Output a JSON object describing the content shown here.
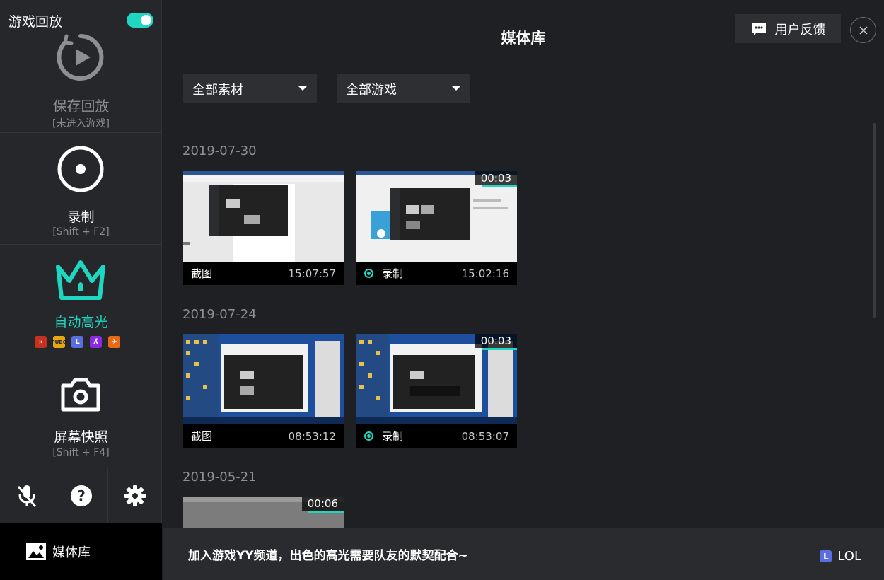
{
  "sidebar": {
    "title": "游戏回放",
    "replay": {
      "label": "保存回放",
      "hint": "[未进入游戏]"
    },
    "record": {
      "label": "录制",
      "hint": "[Shift + F2]"
    },
    "highlight": {
      "label": "自动高光",
      "games": [
        "dota2",
        "PUBG",
        "L",
        "apex",
        "cs"
      ]
    },
    "snapshot": {
      "label": "屏幕快照",
      "hint": "[Shift + F4]"
    },
    "media": {
      "label": "媒体库"
    }
  },
  "header": {
    "title": "媒体库",
    "feedback": "用户反馈"
  },
  "filters": {
    "material": "全部素材",
    "game": "全部游戏"
  },
  "groups": [
    {
      "date": "2019-07-30",
      "items": [
        {
          "type": "截图",
          "time": "15:07:57",
          "duration": ""
        },
        {
          "type": "录制",
          "time": "15:02:16",
          "duration": "00:03"
        }
      ]
    },
    {
      "date": "2019-07-24",
      "items": [
        {
          "type": "截图",
          "time": "08:53:12",
          "duration": ""
        },
        {
          "type": "录制",
          "time": "08:53:07",
          "duration": "00:03"
        }
      ]
    },
    {
      "date": "2019-05-21",
      "items": [
        {
          "type": "",
          "time": "",
          "duration": "00:06"
        }
      ]
    }
  ],
  "bottom": {
    "tip": "加入游戏YY频道，出色的高光需要队友的默契配合~",
    "game_tag": "LOL",
    "game_tag_icon": "L"
  },
  "colors": {
    "accent": "#1fd6c0",
    "background": "#1f2023",
    "sidebar": "#26272b"
  }
}
